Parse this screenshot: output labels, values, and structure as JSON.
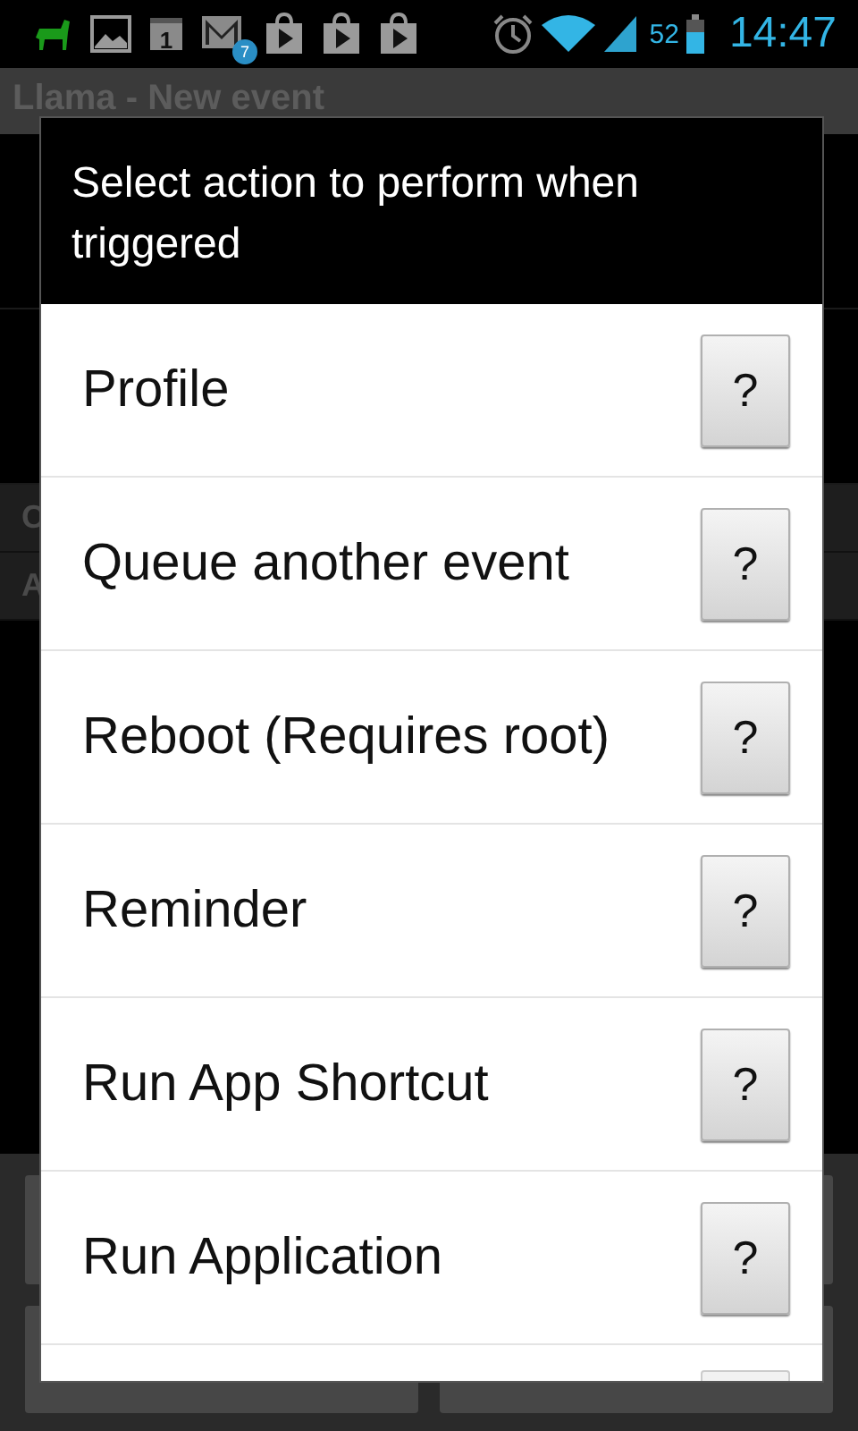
{
  "status_bar": {
    "calendar_day": "1",
    "mail_count": "7",
    "battery": "52",
    "time": "14:47"
  },
  "app_bar": {
    "title": "Llama - New event"
  },
  "background": {
    "sections": [
      {
        "label": "C"
      },
      {
        "label": "A"
      }
    ]
  },
  "dialog": {
    "title": "Select action to perform when triggered",
    "items": [
      {
        "label": "Profile",
        "help": "?"
      },
      {
        "label": "Queue another event",
        "help": "?"
      },
      {
        "label": "Reboot (Requires root)",
        "help": "?"
      },
      {
        "label": "Reminder",
        "help": "?"
      },
      {
        "label": "Run App Shortcut",
        "help": "?"
      },
      {
        "label": "Run Application",
        "help": "?"
      }
    ],
    "more_below": true
  }
}
